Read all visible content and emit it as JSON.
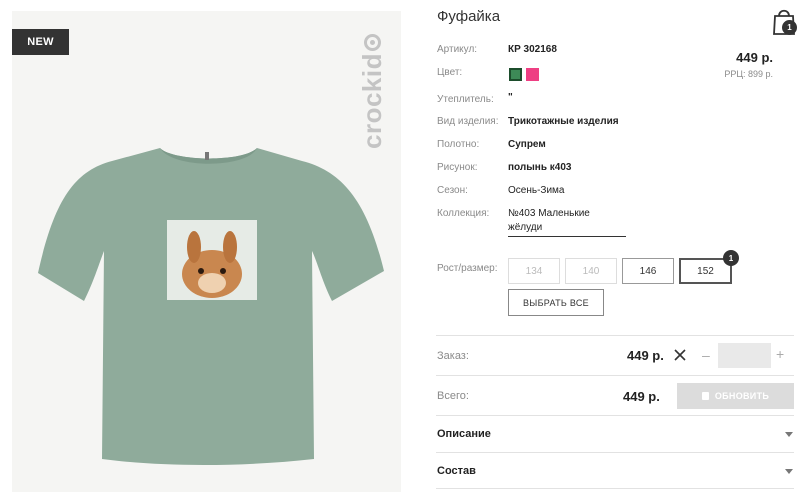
{
  "product": {
    "badge": "NEW",
    "brand": "crockid",
    "title": "Фуфайка"
  },
  "cart": {
    "icon": "shopping-bag-icon",
    "count": "1"
  },
  "props": [
    {
      "label": "Артикул:",
      "value": "КР 302168"
    },
    {
      "label": "Цвет:",
      "value": ""
    },
    {
      "label": "Утеплитель:",
      "value": "\""
    },
    {
      "label": "Вид изделия:",
      "value": "Трикотажные изделия"
    },
    {
      "label": "Полотно:",
      "value": "Супрем"
    },
    {
      "label": "Рисунок:",
      "value": "полынь к403"
    },
    {
      "label": "Сезон:",
      "value": "Осень-Зима"
    },
    {
      "label": "Коллекция:",
      "value": "№403 Маленькие жёлуди"
    }
  ],
  "colors": [
    {
      "name": "green",
      "hex": "#3d8a57",
      "selected": true
    },
    {
      "name": "pink",
      "hex": "#ee3f83",
      "selected": false
    }
  ],
  "price": {
    "main": "449 р.",
    "rrp": "РРЦ: 899 р."
  },
  "sizes": {
    "label": "Рост/размер:",
    "items": [
      {
        "label": "134",
        "state": "disabled"
      },
      {
        "label": "140",
        "state": "disabled"
      },
      {
        "label": "146",
        "state": "available"
      },
      {
        "label": "152",
        "state": "selected",
        "count": "1"
      }
    ],
    "select_all": "ВЫБРАТЬ ВСЕ"
  },
  "order": {
    "label": "Заказ:",
    "price": "449 р.",
    "qty": "",
    "minus": "–",
    "plus": "+"
  },
  "total": {
    "label": "Всего:",
    "price": "449 р.",
    "update": "ОБНОВИТЬ"
  },
  "accordion": [
    {
      "label": "Описание"
    },
    {
      "label": "Состав"
    }
  ],
  "palette": {
    "shirt": "#8fab9b",
    "shirt_shadow": "#7d9a8a",
    "accent_dark": "#333333"
  }
}
